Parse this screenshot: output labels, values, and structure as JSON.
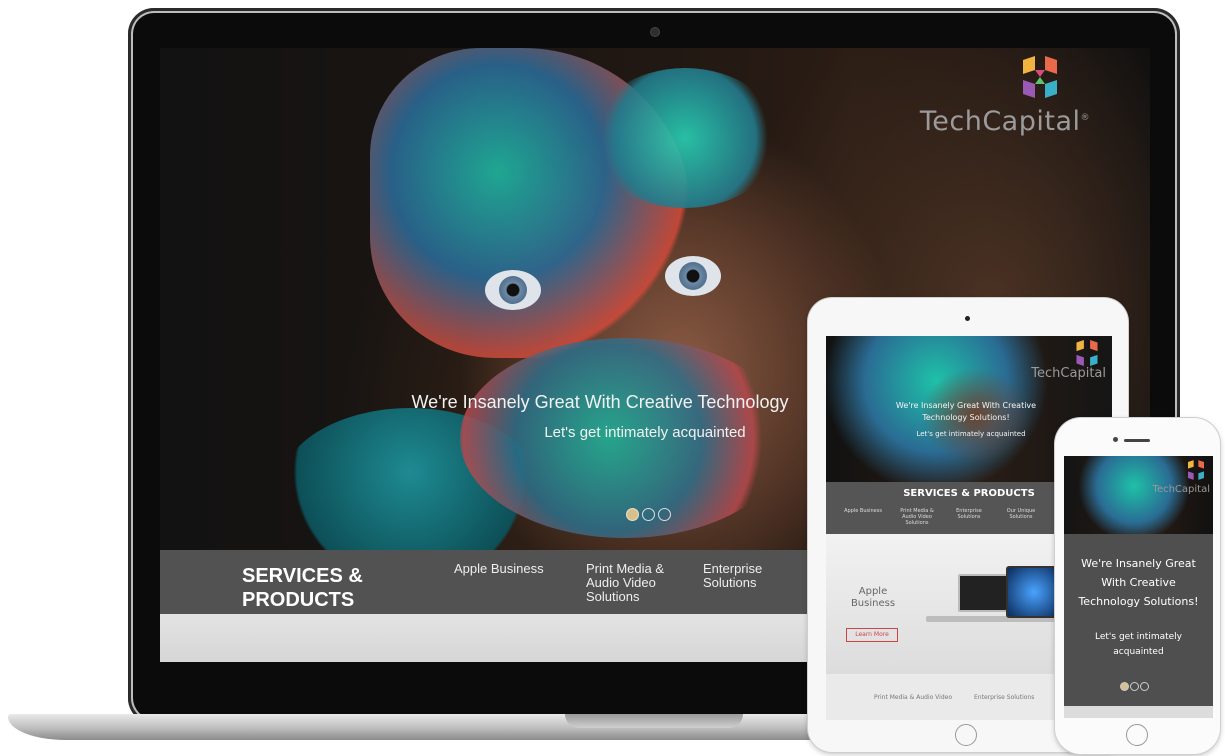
{
  "brand": {
    "name": "TechCapital",
    "registered_mark": "®"
  },
  "laptop": {
    "hero": {
      "headline": "We're Insanely Great With Creative Technology",
      "subline": "Let's get intimately acquainted",
      "carousel": {
        "slides": 3,
        "active_index": 0
      }
    },
    "services": {
      "title": "SERVICES & PRODUCTS",
      "items": [
        "Apple Business",
        "Print Media & Audio Video Solutions",
        "Enterprise Solutions"
      ]
    }
  },
  "tablet": {
    "hero": {
      "headline": "We're Insanely Great With Creative Technology Solutions!",
      "subline": "Let's get intimately acquainted"
    },
    "services": {
      "title": "SERVICES & PRODUCTS",
      "items": [
        "Apple Business",
        "Print Media & Audio Video Solutions",
        "Enterprise Solutions",
        "Our Unique Solutions"
      ]
    },
    "feature": {
      "title": "Apple Business",
      "button": "Learn More"
    },
    "footer_items": [
      "Print Media & Audio Video",
      "Enterprise Solutions"
    ]
  },
  "phone": {
    "hero": {
      "headline": "We're Insanely Great With Creative Technology Solutions!",
      "subline": "Let's get intimately acquainted",
      "carousel": {
        "slides": 3,
        "active_index": 0
      }
    }
  },
  "colors": {
    "services_bar": "#525252",
    "carousel_active": "#d8c08c",
    "learn_more_border": "#cc4444"
  }
}
